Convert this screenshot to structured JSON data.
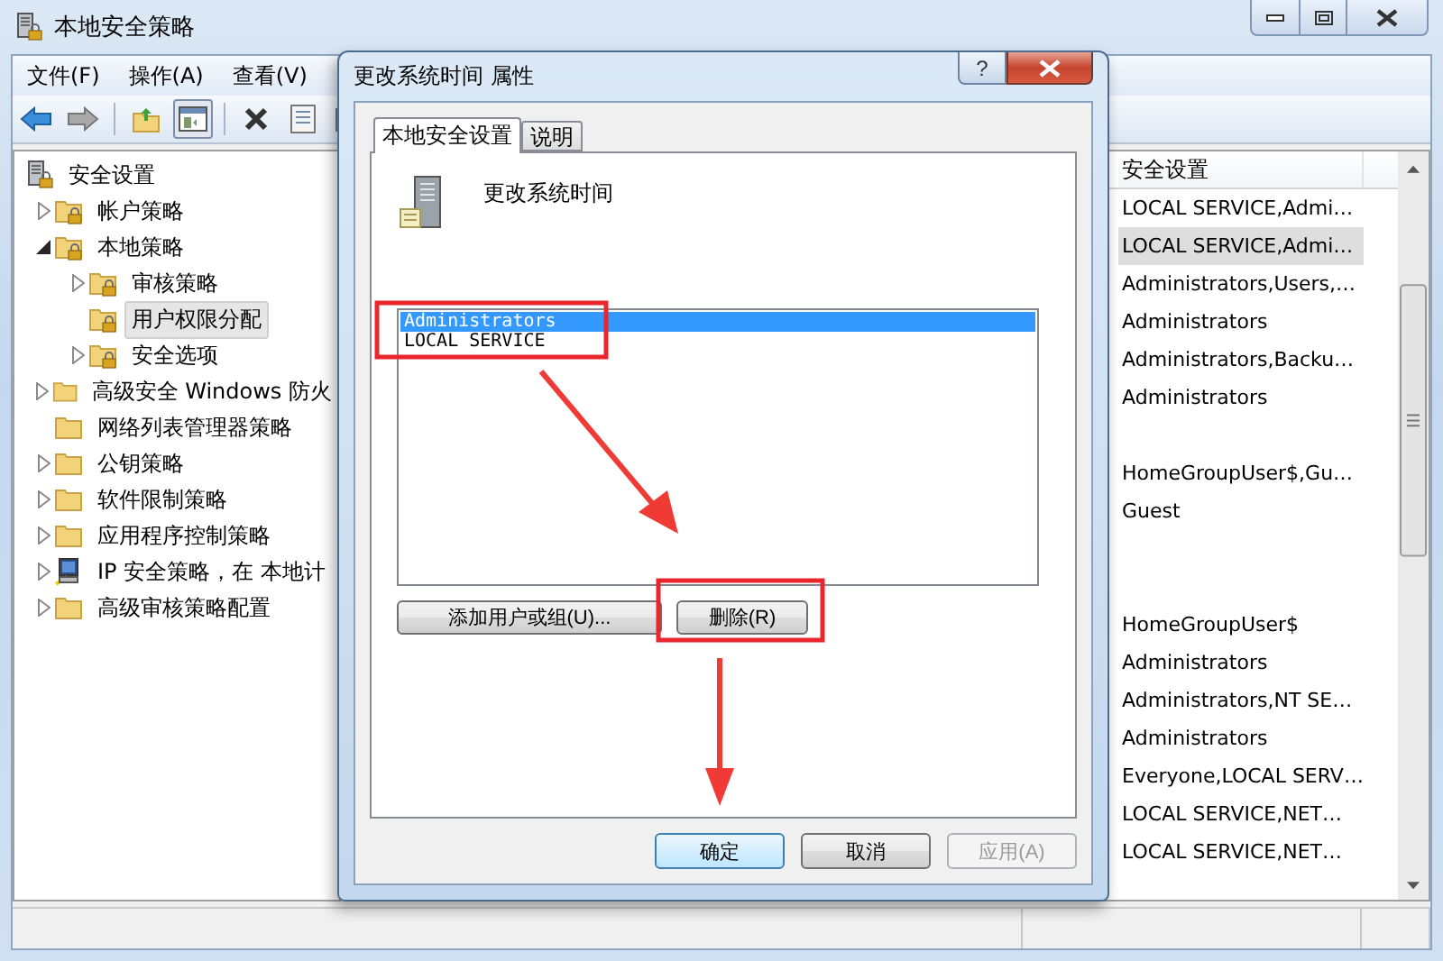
{
  "window": {
    "title": "本地安全策略"
  },
  "menu": [
    "文件(F)",
    "操作(A)",
    "查看(V)"
  ],
  "tree": [
    {
      "label": "安全设置",
      "kind": "root",
      "expandable": false,
      "selected": false,
      "children": [
        {
          "label": "帐户策略",
          "kind": "policy",
          "expandable": true,
          "expanded": false,
          "selected": false
        },
        {
          "label": "本地策略",
          "kind": "policy",
          "expandable": true,
          "expanded": true,
          "selected": false,
          "children": [
            {
              "label": "审核策略",
              "kind": "policy",
              "expandable": true,
              "expanded": false,
              "selected": false
            },
            {
              "label": "用户权限分配",
              "kind": "policy",
              "expandable": false,
              "selected": true
            },
            {
              "label": "安全选项",
              "kind": "policy",
              "expandable": true,
              "expanded": false,
              "selected": false
            }
          ]
        },
        {
          "label": "高级安全 Windows 防火",
          "kind": "folder",
          "expandable": true,
          "expanded": false,
          "selected": false
        },
        {
          "label": "网络列表管理器策略",
          "kind": "folder",
          "expandable": false,
          "selected": false
        },
        {
          "label": "公钥策略",
          "kind": "folder",
          "expandable": true,
          "expanded": false,
          "selected": false
        },
        {
          "label": "软件限制策略",
          "kind": "folder",
          "expandable": true,
          "expanded": false,
          "selected": false
        },
        {
          "label": "应用程序控制策略",
          "kind": "folder",
          "expandable": true,
          "expanded": false,
          "selected": false
        },
        {
          "label": "IP 安全策略，在 本地计",
          "kind": "ip",
          "expandable": true,
          "expanded": false,
          "selected": false
        },
        {
          "label": "高级审核策略配置",
          "kind": "folder",
          "expandable": true,
          "expanded": false,
          "selected": false
        }
      ]
    }
  ],
  "results": {
    "column": "安全设置",
    "rows": [
      {
        "kind": "value",
        "text": "LOCAL SERVICE,Admi…",
        "selected": false
      },
      {
        "kind": "value",
        "text": "LOCAL SERVICE,Admi…",
        "selected": true
      },
      {
        "kind": "value",
        "text": "Administrators,Users,…",
        "selected": false
      },
      {
        "kind": "value",
        "text": "Administrators",
        "selected": false
      },
      {
        "kind": "value",
        "text": "Administrators,Backu…",
        "selected": false
      },
      {
        "kind": "value",
        "text": "Administrators",
        "selected": false
      },
      {
        "kind": "empty",
        "selected": false
      },
      {
        "kind": "value",
        "text": "HomeGroupUser$,Gu…",
        "selected": false
      },
      {
        "kind": "value",
        "text": "Guest",
        "selected": false
      },
      {
        "kind": "empty",
        "selected": false
      },
      {
        "kind": "empty",
        "selected": false
      },
      {
        "kind": "value",
        "text": "HomeGroupUser$",
        "selected": false
      },
      {
        "kind": "value",
        "text": "Administrators",
        "selected": false
      },
      {
        "kind": "value",
        "text": "Administrators,NT SE…",
        "selected": false
      },
      {
        "kind": "value",
        "text": "Administrators",
        "selected": false
      },
      {
        "kind": "value",
        "text": "Everyone,LOCAL SERV…",
        "selected": false
      },
      {
        "kind": "value",
        "text": "LOCAL SERVICE,NET…",
        "selected": false
      },
      {
        "kind": "value",
        "text": "LOCAL SERVICE,NET…",
        "selected": false
      }
    ]
  },
  "dialog": {
    "title": "更改系统时间 属性",
    "help": "?",
    "tabs": [
      {
        "label": "本地安全设置",
        "selected": true
      },
      {
        "label": "说明",
        "selected": false
      }
    ],
    "policy": "更改系统时间",
    "members": [
      {
        "name": "Administrators",
        "selected": true
      },
      {
        "name": "LOCAL SERVICE",
        "selected": false
      }
    ],
    "member_buttons": [
      "添加用户或组(U)...",
      "删除(R)"
    ],
    "buttons": [
      {
        "label": "确定",
        "kind": "default",
        "disabled": false
      },
      {
        "label": "取消",
        "kind": "normal",
        "disabled": false
      },
      {
        "label": "应用(A)",
        "kind": "normal",
        "disabled": true
      }
    ]
  }
}
